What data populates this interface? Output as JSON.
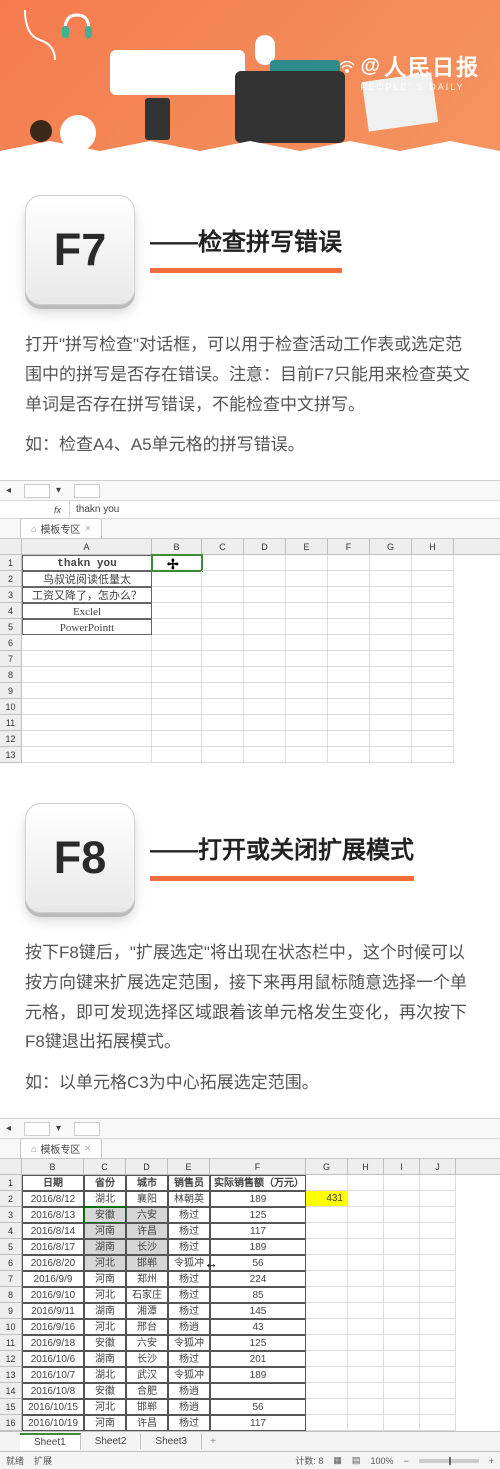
{
  "brand": {
    "cn": "人民日报",
    "en": "PEOPLE' S DAILY",
    "at": "@"
  },
  "f7": {
    "key": "F7",
    "title": "——检查拼写错误",
    "body": "打开\"拼写检查\"对话框，可以用于检查活动工作表或选定范围中的拼写是否存在错误。注意：目前F7只能用来检查英文单词是否存在拼写错误，不能检查中文拼写。",
    "example": "如：检查A4、A5单元格的拼写错误。"
  },
  "f8": {
    "key": "F8",
    "title": "——打开或关闭扩展模式",
    "body": "按下F8键后，\"扩展选定\"将出现在状态栏中，这个时候可以按方向键来扩展选定范围，接下来再用鼠标随意选择一个单元格，即可发现选择区域跟着该单元格发生变化，再次按下F8键退出拓展模式。",
    "example": "如：以单元格C3为中心拓展选定范围。"
  },
  "ss1": {
    "fx_label": "fx",
    "fx_value": "thakn you",
    "tab": "模板专区",
    "cols": [
      "A",
      "B",
      "C",
      "D",
      "E",
      "F",
      "G",
      "H"
    ],
    "rows": [
      "1",
      "2",
      "3",
      "4",
      "5",
      "6",
      "7",
      "8",
      "9",
      "10",
      "11",
      "12",
      "13"
    ],
    "a1": "thakn you",
    "a2": "鸟叔说阅读低量太",
    "a3": "工资又降了，怎办么？",
    "a4": "Exclel",
    "a5": "PowerPointt"
  },
  "ss2": {
    "tab": "模板专区",
    "cols": [
      "B",
      "C",
      "D",
      "E",
      "F",
      "G",
      "H",
      "I",
      "J"
    ],
    "rownums": [
      "1",
      "2",
      "3",
      "4",
      "5",
      "6",
      "7",
      "8",
      "9",
      "10",
      "11",
      "12",
      "13",
      "14",
      "15",
      "16"
    ],
    "headers": {
      "b": "日期",
      "c": "省份",
      "d": "城市",
      "e": "销售员",
      "f": "实际销售额（万元）"
    },
    "g2": "431",
    "rows": [
      {
        "b": "2016/8/12",
        "c": "湖北",
        "d": "襄阳",
        "e": "林朝英",
        "f": "189"
      },
      {
        "b": "2016/8/13",
        "c": "安徽",
        "d": "六安",
        "e": "杨过",
        "f": "125"
      },
      {
        "b": "2016/8/14",
        "c": "河南",
        "d": "许昌",
        "e": "杨过",
        "f": "117"
      },
      {
        "b": "2016/8/17",
        "c": "湖南",
        "d": "长沙",
        "e": "杨过",
        "f": "189"
      },
      {
        "b": "2016/8/20",
        "c": "河北",
        "d": "邯郸",
        "e": "令狐冲",
        "f": "56"
      },
      {
        "b": "2016/9/9",
        "c": "河南",
        "d": "郑州",
        "e": "杨过",
        "f": "224"
      },
      {
        "b": "2016/9/10",
        "c": "河北",
        "d": "石家庄",
        "e": "杨过",
        "f": "85"
      },
      {
        "b": "2016/9/11",
        "c": "湖南",
        "d": "湘潭",
        "e": "杨过",
        "f": "145"
      },
      {
        "b": "2016/9/16",
        "c": "河北",
        "d": "邢台",
        "e": "杨逍",
        "f": "43"
      },
      {
        "b": "2016/9/18",
        "c": "安徽",
        "d": "六安",
        "e": "令狐冲",
        "f": "125"
      },
      {
        "b": "2016/10/6",
        "c": "湖南",
        "d": "长沙",
        "e": "杨过",
        "f": "201"
      },
      {
        "b": "2016/10/7",
        "c": "湖北",
        "d": "武汉",
        "e": "令狐冲",
        "f": "189"
      },
      {
        "b": "2016/10/8",
        "c": "安徽",
        "d": "合肥",
        "e": "杨逍",
        "f": ""
      },
      {
        "b": "2016/10/15",
        "c": "河北",
        "d": "邯郸",
        "e": "杨逍",
        "f": "56"
      },
      {
        "b": "2016/10/19",
        "c": "河南",
        "d": "许昌",
        "e": "杨过",
        "f": "117"
      }
    ],
    "sheets": [
      "Sheet1",
      "Sheet2",
      "Sheet3"
    ],
    "status_left": "就绪",
    "status_ext": "扩展",
    "status_count_label": "计数:",
    "status_count": "8",
    "zoom": "100%"
  }
}
